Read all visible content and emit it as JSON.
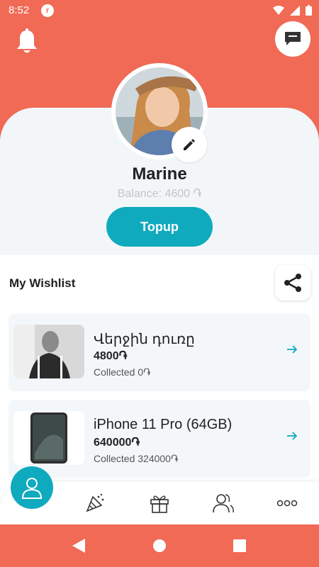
{
  "status": {
    "time": "8:52"
  },
  "profile": {
    "name": "Marine",
    "balance": "Balance: 4600 ֏",
    "topup_label": "Topup"
  },
  "wishlist": {
    "title": "My Wishlist",
    "items": [
      {
        "title": "Վերջին դուռը",
        "price": "4800֏",
        "collected": "Collected 0֏"
      },
      {
        "title": "iPhone 11 Pro (64GB)",
        "price": "640000֏",
        "collected": "Collected 324000֏"
      }
    ]
  },
  "icons": {
    "notifications": "bell-icon",
    "chat": "chat-icon",
    "edit": "pencil-icon",
    "share": "share-icon",
    "profile": "user-icon",
    "nav": [
      "party-icon",
      "gift-icon",
      "friends-icon",
      "more-icon"
    ]
  },
  "colors": {
    "primary": "#f06a55",
    "accent": "#10aabf"
  }
}
